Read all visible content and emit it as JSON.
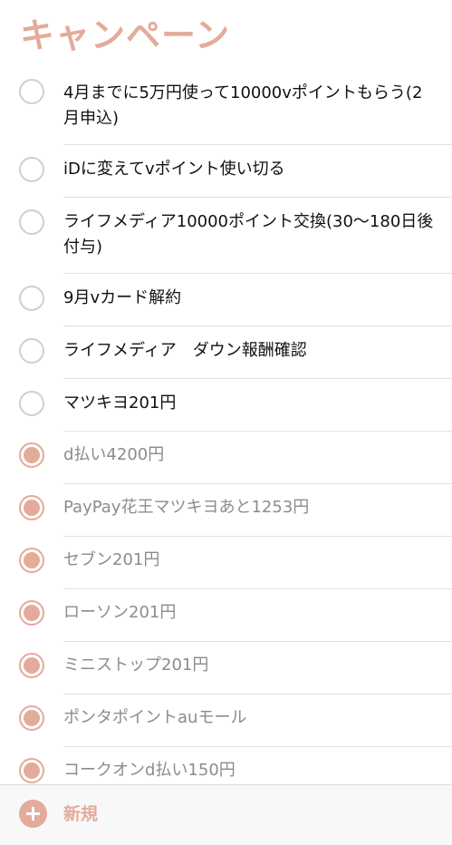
{
  "title": "キャンペーン",
  "accent_color": "#e3ab9a",
  "items": [
    {
      "text": "4月までに5万円使って10000vポイントもらう(2月申込)",
      "completed": false
    },
    {
      "text": "iDに変えてvポイント使い切る",
      "completed": false
    },
    {
      "text": "ライフメディア10000ポイント交換(30〜180日後付与)",
      "completed": false
    },
    {
      "text": "9月vカード解約",
      "completed": false
    },
    {
      "text": "ライフメディア　ダウン報酬確認",
      "completed": false
    },
    {
      "text": "マツキヨ201円",
      "completed": false
    },
    {
      "text": "d払い4200円",
      "completed": true
    },
    {
      "text": "PayPay花王マツキヨあと1253円",
      "completed": true
    },
    {
      "text": "セブン201円",
      "completed": true
    },
    {
      "text": "ローソン201円",
      "completed": true
    },
    {
      "text": "ミニストップ201円",
      "completed": true
    },
    {
      "text": "ポンタポイントauモール",
      "completed": true
    },
    {
      "text": "コークオンd払い150円",
      "completed": true
    }
  ],
  "footer": {
    "add_label": "新規",
    "add_icon": "plus-circle-icon"
  }
}
